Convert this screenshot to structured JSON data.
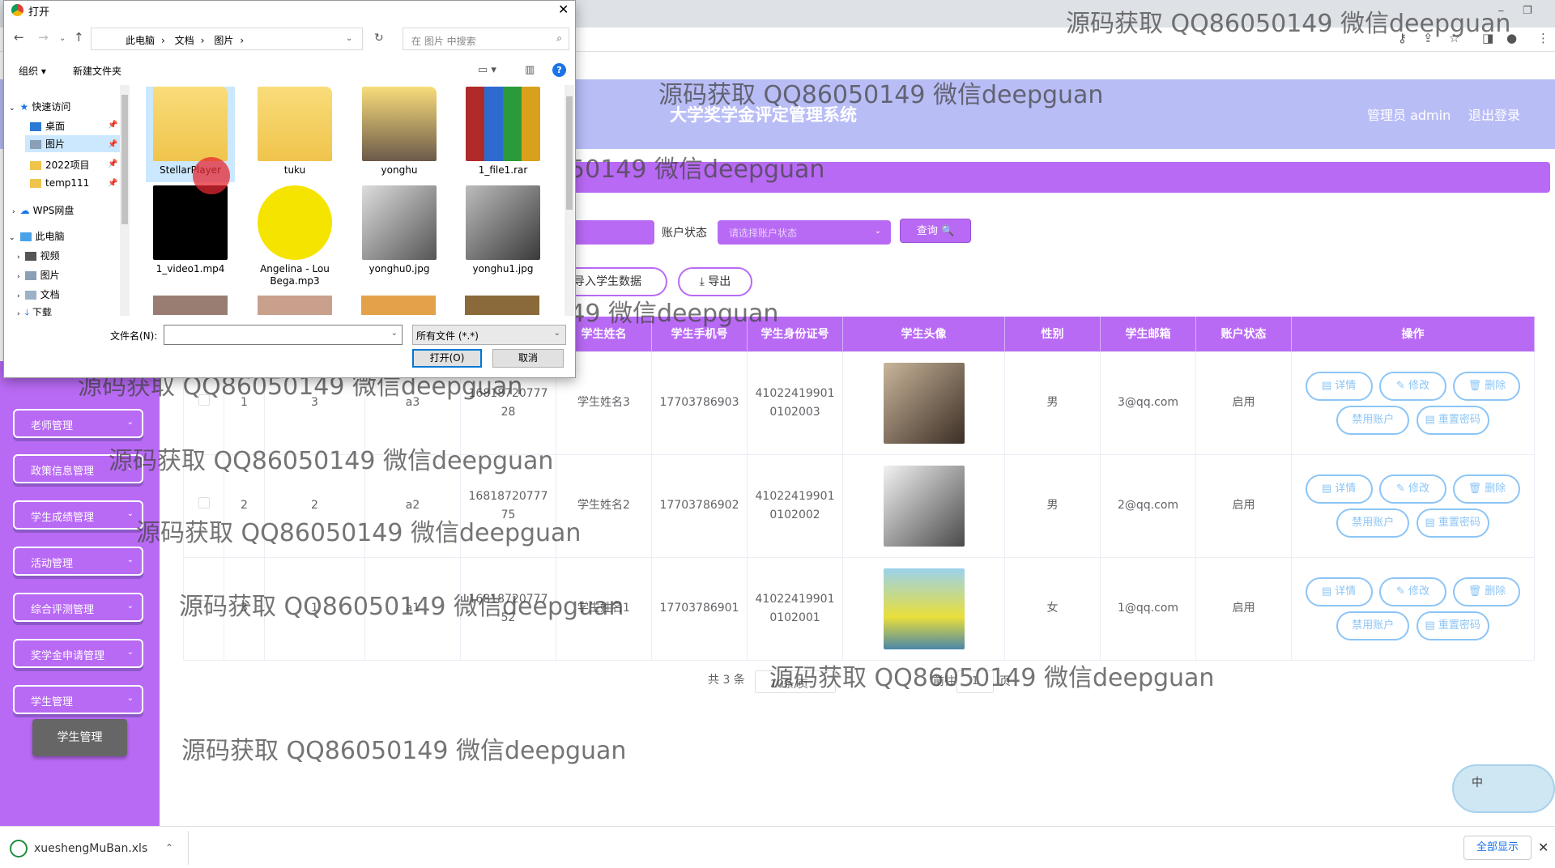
{
  "browser": {
    "minimize": "⎯",
    "restore": "❐",
    "close": "✕"
  },
  "app": {
    "title": "大学奖学金评定管理系统",
    "admin_label": "管理员 admin",
    "logout": "退出登录"
  },
  "sidebar": {
    "items": [
      {
        "label": "老师管理"
      },
      {
        "label": "政策信息管理"
      },
      {
        "label": "学生成绩管理"
      },
      {
        "label": "活动管理"
      },
      {
        "label": "综合评测管理"
      },
      {
        "label": "奖学金申请管理"
      },
      {
        "label": "学生管理"
      }
    ],
    "active_sub": "学生管理"
  },
  "search": {
    "status_label": "账户状态",
    "status_placeholder": "请选择账户状态",
    "query_button": "查询 🔍"
  },
  "actions": {
    "import_button": "导入学生数据",
    "export_button": "⤓ 导出"
  },
  "table": {
    "headers": [
      "",
      "",
      "",
      "",
      "",
      "学生姓名",
      "学生手机号",
      "学生身份证号",
      "学生头像",
      "性别",
      "学生邮箱",
      "账户状态",
      "操作"
    ],
    "rows": [
      {
        "idx": "1",
        "c2": "3",
        "c3": "a3",
        "c4": "16818720777\n28",
        "name": "学生姓名3",
        "phone": "17703786903",
        "idcard": "41022419901\n0102003",
        "gender": "男",
        "email": "3@qq.com",
        "status": "启用"
      },
      {
        "idx": "2",
        "c2": "2",
        "c3": "a2",
        "c4": "16818720777\n75",
        "name": "学生姓名2",
        "phone": "17703786902",
        "idcard": "41022419901\n0102002",
        "gender": "男",
        "email": "2@qq.com",
        "status": "启用"
      },
      {
        "idx": "3",
        "c2": "1",
        "c3": "a1",
        "c4": "16818720777\n52",
        "name": "学生姓名1",
        "phone": "17703786901",
        "idcard": "41022419901\n0102001",
        "gender": "女",
        "email": "1@qq.com",
        "status": "启用"
      }
    ],
    "ops": {
      "detail": "▤ 详情",
      "edit": "✎ 修改",
      "delete": "🗑 删除",
      "disable": "禁用账户",
      "reset": "▤ 重置密码"
    }
  },
  "pagination": {
    "total": "共 3 条",
    "page_size": "10条/页",
    "goto_label": "前往",
    "goto_value": "1",
    "goto_suffix": "页"
  },
  "watermark": "源码获取 QQ86050149 微信deepguan",
  "float_widget": "中",
  "download_bar": {
    "file": "xueshengMuBan.xls",
    "show_all": "全部显示",
    "close": "✕"
  },
  "dialog": {
    "title": "打开",
    "close": "✕",
    "breadcrumb": [
      "此电脑",
      "文档",
      "图片"
    ],
    "search_placeholder": "在 图片 中搜索",
    "organize": "组织 ▾",
    "new_folder": "新建文件夹",
    "help": "?",
    "nav": {
      "quick_access": "快速访问",
      "desktop": "桌面",
      "pictures": "图片",
      "project": "2022项目",
      "temp": "temp111",
      "wps": "WPS网盘",
      "this_pc": "此电脑",
      "videos": "视频",
      "pictures2": "图片",
      "documents": "文档",
      "downloads": "下载"
    },
    "files": [
      {
        "name": "StellarPlayer"
      },
      {
        "name": "tuku"
      },
      {
        "name": "yonghu"
      },
      {
        "name": "1_file1.rar"
      },
      {
        "name": "1_video1.mp4"
      },
      {
        "name": "Angelina - Lou Bega.mp3"
      },
      {
        "name": "yonghu0.jpg"
      },
      {
        "name": "yonghu1.jpg"
      }
    ],
    "filename_label": "文件名(N):",
    "filetype": "所有文件 (*.*)",
    "open_button": "打开(O)",
    "cancel_button": "取消"
  }
}
